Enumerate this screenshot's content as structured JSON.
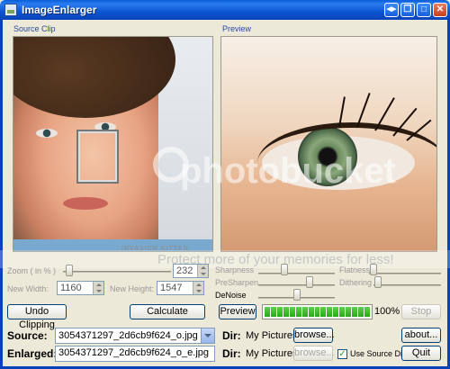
{
  "window": {
    "title": "ImageEnlarger"
  },
  "titlebar_buttons": [
    "◀▶",
    "❐",
    "□",
    "✕"
  ],
  "panels": {
    "source_label": "Source Clip",
    "preview_label": "Preview"
  },
  "watermarks": {
    "photobucket": "photobucket",
    "promo": "Protect more of your memories for less!",
    "photo_credit": "INVASION KITTEN"
  },
  "zoom": {
    "label": "Zoom ( in % )",
    "value": "232"
  },
  "new_width": {
    "label": "New Width:",
    "value": "1160"
  },
  "new_height": {
    "label": "New Height:",
    "value": "1547"
  },
  "filters": {
    "sharpness": "Sharpness",
    "presharpen": "PreSharpen",
    "denoise": "DeNoise",
    "flatness": "Flatness",
    "dithering": "Dithering"
  },
  "buttons": {
    "undo_clipping": "Undo Clipping",
    "calculate": "Calculate",
    "preview": "Preview",
    "stop": "Stop",
    "about": "about...",
    "browse_source": "browse...",
    "browse_enlarged": "browse...",
    "quit": "Quit"
  },
  "progress": {
    "percent_text": "100%",
    "fraction": 1.0
  },
  "source": {
    "label": "Source:",
    "value": "3054371297_2d6cb9f624_o.jpg"
  },
  "enlarged": {
    "label": "Enlarged:",
    "value": "3054371297_2d6cb9f624_o_e.jpg"
  },
  "dir_label": "Dir:",
  "source_dir": "My Pictures",
  "enlarged_dir": "My Pictures",
  "use_source_dir": {
    "label": "Use Source Dir.",
    "checked": true
  }
}
